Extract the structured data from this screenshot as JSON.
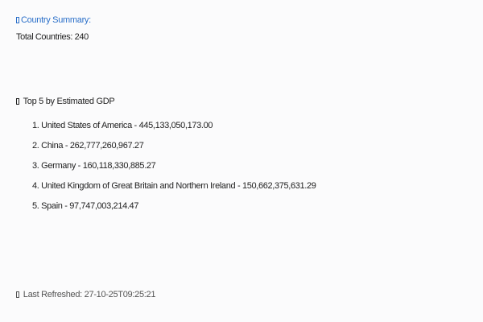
{
  "summary": {
    "title": "Country Summary:",
    "title_color": "#2a6fc9",
    "icon": "placeholder-box-icon",
    "total_countries": "Total Countries: 240"
  },
  "gdp": {
    "heading": "Top 5 by Estimated GDP",
    "icon": "placeholder-box-icon",
    "items": [
      "1. United States of America - 445,133,050,173.00",
      "2. China - 262,777,260,967.27",
      "3. Germany - 160,118,330,885.27",
      "4. United Kingdom of Great Britain and Northern Ireland - 150,662,375,631.29",
      "5. Spain - 97,747,003,214.47"
    ]
  },
  "footer": {
    "last_refreshed": "Last Refreshed: 27-10-25T09:25:21",
    "icon": "placeholder-box-icon"
  }
}
